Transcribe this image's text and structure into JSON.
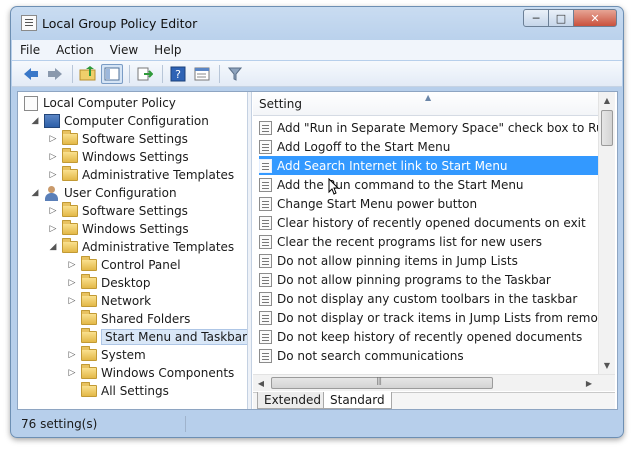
{
  "window": {
    "title": "Local Group Policy Editor"
  },
  "window_buttons": {
    "minimize": "─",
    "maximize": "□",
    "close": "✕"
  },
  "menu": [
    "File",
    "Action",
    "View",
    "Help"
  ],
  "tree": {
    "root": "Local Computer Policy",
    "computer_configuration": "Computer Configuration",
    "cc_software_settings": "Software Settings",
    "cc_windows_settings": "Windows Settings",
    "cc_administrative_templates": "Administrative Templates",
    "user_configuration": "User Configuration",
    "uc_software_settings": "Software Settings",
    "uc_windows_settings": "Windows Settings",
    "uc_administrative_templates": "Administrative Templates",
    "control_panel": "Control Panel",
    "desktop": "Desktop",
    "network": "Network",
    "shared_folders": "Shared Folders",
    "start_menu_and_taskbar": "Start Menu and Taskbar",
    "system": "System",
    "windows_components": "Windows Components",
    "all_settings": "All Settings"
  },
  "list": {
    "column_header": "Setting",
    "rows": [
      "Add \"Run in Separate Memory Space\" check box to Run dial...",
      "Add Logoff to the Start Menu",
      "Add Search Internet link to Start Menu",
      "Add the Run command to the Start Menu",
      "Change Start Menu power button",
      "Clear history of recently opened documents on exit",
      "Clear the recent programs list for new users",
      "Do not allow pinning items in Jump Lists",
      "Do not allow pinning programs to the Taskbar",
      "Do not display any custom toolbars in the taskbar",
      "Do not display or track items in Jump Lists from remote loca...",
      "Do not keep history of recently opened documents",
      "Do not search communications"
    ],
    "selected_index": 2
  },
  "tabs": {
    "extended": "Extended",
    "standard": "Standard"
  },
  "status": {
    "text": "76 setting(s)"
  }
}
